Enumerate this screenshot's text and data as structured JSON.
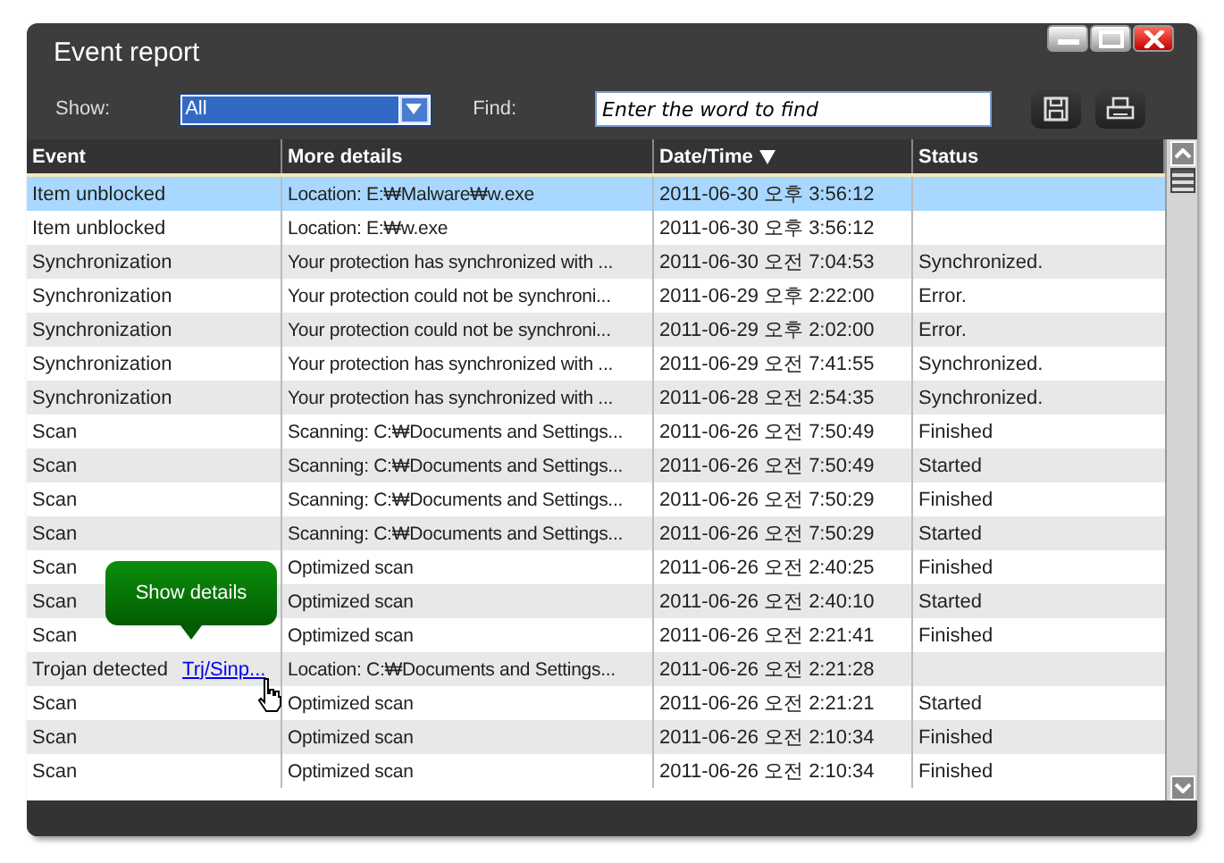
{
  "window": {
    "title": "Event report"
  },
  "toolbar": {
    "show_label": "Show:",
    "show_value": "All",
    "find_label": "Find:",
    "find_placeholder": "Enter the word to find"
  },
  "table": {
    "columns": [
      {
        "label": "Event",
        "sorted": false
      },
      {
        "label": "More details",
        "sorted": false
      },
      {
        "label": "Date/Time",
        "sorted": true
      },
      {
        "label": "Status",
        "sorted": false
      }
    ],
    "rows": [
      {
        "event": "Item unblocked",
        "details": "Location: E:₩Malware₩w.exe",
        "datetime": "2011-06-30 오후 3:56:12",
        "status": "",
        "selected": true
      },
      {
        "event": "Item unblocked",
        "details": "Location: E:₩w.exe",
        "datetime": "2011-06-30 오후 3:56:12",
        "status": "",
        "selected": false
      },
      {
        "event": "Synchronization",
        "details": "Your protection has synchronized with ...",
        "datetime": "2011-06-30 오전 7:04:53",
        "status": "Synchronized.",
        "selected": false
      },
      {
        "event": "Synchronization",
        "details": "Your protection could not be synchroni...",
        "datetime": "2011-06-29 오후 2:22:00",
        "status": "Error.",
        "selected": false
      },
      {
        "event": "Synchronization",
        "details": "Your protection could not be synchroni...",
        "datetime": "2011-06-29 오후 2:02:00",
        "status": "Error.",
        "selected": false
      },
      {
        "event": "Synchronization",
        "details": "Your protection has synchronized with ...",
        "datetime": "2011-06-29 오전 7:41:55",
        "status": "Synchronized.",
        "selected": false
      },
      {
        "event": "Synchronization",
        "details": "Your protection has synchronized with ...",
        "datetime": "2011-06-28 오전 2:54:35",
        "status": "Synchronized.",
        "selected": false
      },
      {
        "event": "Scan",
        "details": "Scanning: C:₩Documents and Settings...",
        "datetime": "2011-06-26 오전 7:50:49",
        "status": "Finished",
        "selected": false
      },
      {
        "event": "Scan",
        "details": "Scanning: C:₩Documents and Settings...",
        "datetime": "2011-06-26 오전 7:50:49",
        "status": "Started",
        "selected": false
      },
      {
        "event": "Scan",
        "details": "Scanning: C:₩Documents and Settings...",
        "datetime": "2011-06-26 오전 7:50:29",
        "status": "Finished",
        "selected": false
      },
      {
        "event": "Scan",
        "details": "Scanning: C:₩Documents and Settings...",
        "datetime": "2011-06-26 오전 7:50:29",
        "status": "Started",
        "selected": false
      },
      {
        "event": "Scan",
        "details": "Optimized scan",
        "datetime": "2011-06-26 오전 2:40:25",
        "status": "Finished",
        "selected": false
      },
      {
        "event": "Scan",
        "details": "Optimized scan",
        "datetime": "2011-06-26 오전 2:40:10",
        "status": "Started",
        "selected": false
      },
      {
        "event": "Scan",
        "details": "Optimized scan",
        "datetime": "2011-06-26 오전 2:21:41",
        "status": "Finished",
        "selected": false
      },
      {
        "event": "Trojan detected",
        "link": "Trj/Sinp...",
        "details": "Location: C:₩Documents and Settings...",
        "datetime": "2011-06-26 오전 2:21:28",
        "status": "",
        "selected": false
      },
      {
        "event": "Scan",
        "details": "Optimized scan",
        "datetime": "2011-06-26 오전 2:21:21",
        "status": "Started",
        "selected": false
      },
      {
        "event": "Scan",
        "details": "Optimized scan",
        "datetime": "2011-06-26 오전 2:10:34",
        "status": "Finished",
        "selected": false
      },
      {
        "event": "Scan",
        "details": "Optimized scan",
        "datetime": "2011-06-26 오전 2:10:34",
        "status": "Finished",
        "selected": false
      }
    ]
  },
  "tooltip": {
    "text": "Show details"
  }
}
